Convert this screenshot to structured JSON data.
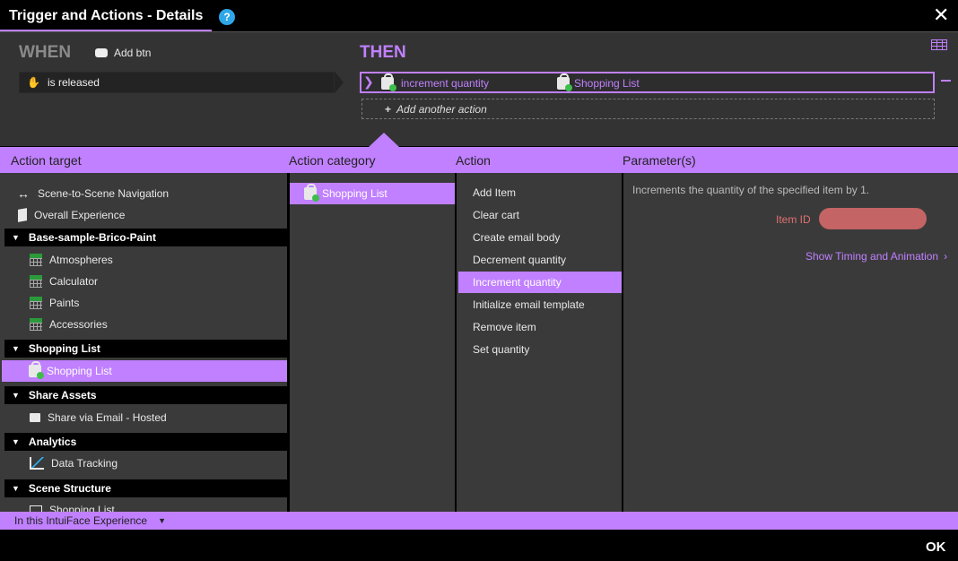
{
  "window": {
    "title": "Trigger and Actions - Details",
    "help_label": "?",
    "close_label": "✕"
  },
  "trigger": {
    "when_label": "WHEN",
    "object_name": "Add btn",
    "event": "is released"
  },
  "actions": {
    "then_label": "THEN",
    "current": {
      "verb": "increment quantity",
      "target": "Shopping List"
    },
    "add_another": "Add another action"
  },
  "headers": {
    "target": "Action target",
    "category": "Action category",
    "action": "Action",
    "params": "Parameter(s)"
  },
  "target_tree": {
    "nav": "Scene-to-Scene Navigation",
    "experience": "Overall Experience",
    "sections": [
      {
        "title": "Base-sample-Brico-Paint",
        "items": [
          "Atmospheres",
          "Calculator",
          "Paints",
          "Accessories"
        ]
      },
      {
        "title": "Shopping List",
        "items": [
          "Shopping List"
        ]
      },
      {
        "title": "Share Assets",
        "items": [
          "Share via Email - Hosted"
        ]
      },
      {
        "title": "Analytics",
        "items": [
          "Data Tracking"
        ]
      },
      {
        "title": "Scene Structure",
        "items": [
          "Shopping List"
        ]
      }
    ]
  },
  "categories": [
    "Shopping List"
  ],
  "action_list": [
    "Add Item",
    "Clear cart",
    "Create email body",
    "Decrement quantity",
    "Increment quantity",
    "Initialize email template",
    "Remove item",
    "Set quantity"
  ],
  "params": {
    "description": "Increments the quantity of the specified item by 1.",
    "item_id_label": "Item ID",
    "item_id_value": "",
    "timing_link": "Show Timing and Animation"
  },
  "footer": {
    "scope": "In this IntuiFace Experience",
    "ok_label": "OK"
  },
  "colors": {
    "accent": "#c080ff",
    "error": "#c46464",
    "panel": "#3a3a3a"
  }
}
